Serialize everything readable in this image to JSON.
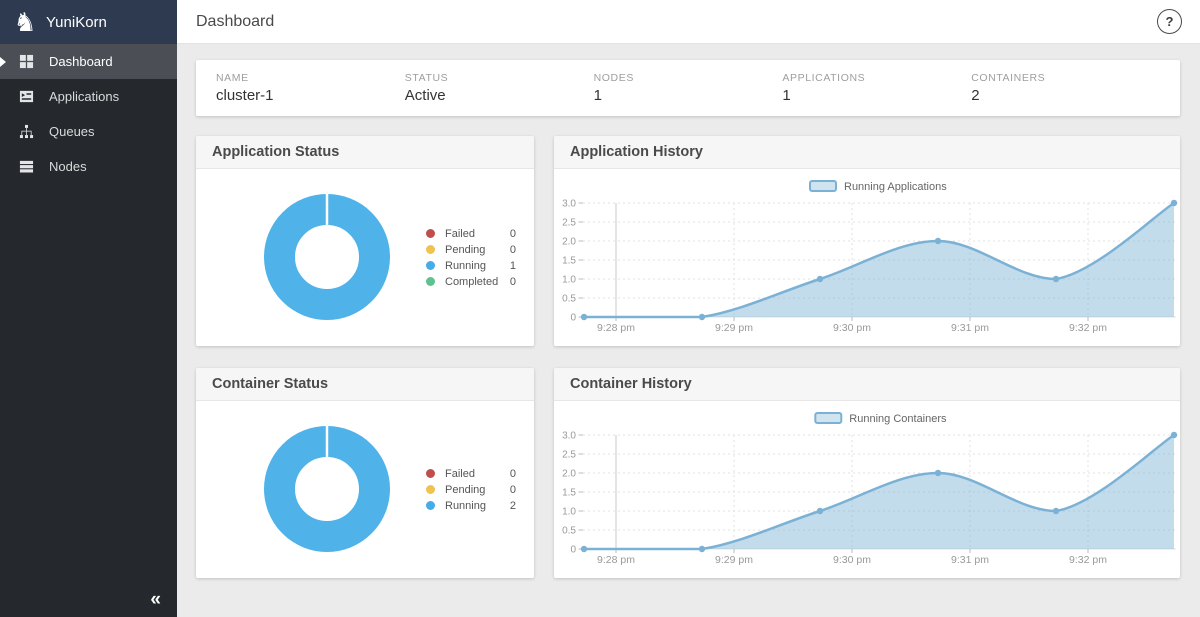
{
  "sidebar": {
    "brand": "YuniKorn",
    "logo_glyph": "♞",
    "items": [
      {
        "label": "Dashboard",
        "icon": "dashboard-icon",
        "active": true
      },
      {
        "label": "Applications",
        "icon": "applications-icon",
        "active": false
      },
      {
        "label": "Queues",
        "icon": "queues-icon",
        "active": false
      },
      {
        "label": "Nodes",
        "icon": "nodes-icon",
        "active": false
      }
    ],
    "collapse_glyph": "«"
  },
  "topbar": {
    "title": "Dashboard",
    "help_glyph": "?"
  },
  "cluster_card": {
    "fields": [
      {
        "label": "NAME",
        "value": "cluster-1"
      },
      {
        "label": "STATUS",
        "value": "Active"
      },
      {
        "label": "NODES",
        "value": "1"
      },
      {
        "label": "APPLICATIONS",
        "value": "1"
      },
      {
        "label": "CONTAINERS",
        "value": "2"
      }
    ]
  },
  "colors": {
    "donut_blue": "#4fb2e9",
    "failed_red": "#bf4e4e",
    "pending_amber": "#f0c24e",
    "running_blue": "#45ace8",
    "completed_green": "#5ec28f",
    "history_line": "#7ab1d4",
    "history_fill": "rgba(122,177,212,0.45)",
    "legend_swatch_fill": "#cfe4ee"
  },
  "chart_data": [
    {
      "type": "pie",
      "title": "Application Status",
      "donut_color": "#4fb2e9",
      "slices": [
        {
          "label": "Failed",
          "value": 0,
          "color": "#bf4e4e"
        },
        {
          "label": "Pending",
          "value": 0,
          "color": "#f0c24e"
        },
        {
          "label": "Running",
          "value": 1,
          "color": "#45ace8"
        },
        {
          "label": "Completed",
          "value": 0,
          "color": "#5ec28f"
        }
      ]
    },
    {
      "type": "area",
      "title": "Application History",
      "series": [
        {
          "name": "Running Applications",
          "values": [
            0,
            0,
            1,
            2,
            1,
            3
          ]
        }
      ],
      "x_labels": [
        "9:28 pm",
        "9:29 pm",
        "9:30 pm",
        "9:31 pm",
        "9:32 pm"
      ],
      "ytick_labels": [
        "0",
        "0.5",
        "1.0",
        "1.5",
        "2.0",
        "2.5",
        "3.0"
      ],
      "yticks": [
        0,
        0.5,
        1,
        1.5,
        2,
        2.5,
        3
      ],
      "ylim": [
        0,
        3
      ],
      "legend_position": "top-center",
      "grid": true,
      "line_color": "#7ab1d4",
      "fill_color": "rgba(122,177,212,0.45)"
    },
    {
      "type": "pie",
      "title": "Container Status",
      "donut_color": "#4fb2e9",
      "slices": [
        {
          "label": "Failed",
          "value": 0,
          "color": "#bf4e4e"
        },
        {
          "label": "Pending",
          "value": 0,
          "color": "#f0c24e"
        },
        {
          "label": "Running",
          "value": 2,
          "color": "#45ace8"
        }
      ]
    },
    {
      "type": "area",
      "title": "Container History",
      "series": [
        {
          "name": "Running Containers",
          "values": [
            0,
            0,
            1,
            2,
            1,
            3
          ]
        }
      ],
      "x_labels": [
        "9:28 pm",
        "9:29 pm",
        "9:30 pm",
        "9:31 pm",
        "9:32 pm"
      ],
      "ytick_labels": [
        "0",
        "0.5",
        "1.0",
        "1.5",
        "2.0",
        "2.5",
        "3.0"
      ],
      "yticks": [
        0,
        0.5,
        1,
        1.5,
        2,
        2.5,
        3
      ],
      "ylim": [
        0,
        3
      ],
      "legend_position": "top-center",
      "grid": true,
      "line_color": "#7ab1d4",
      "fill_color": "rgba(122,177,212,0.45)"
    }
  ]
}
